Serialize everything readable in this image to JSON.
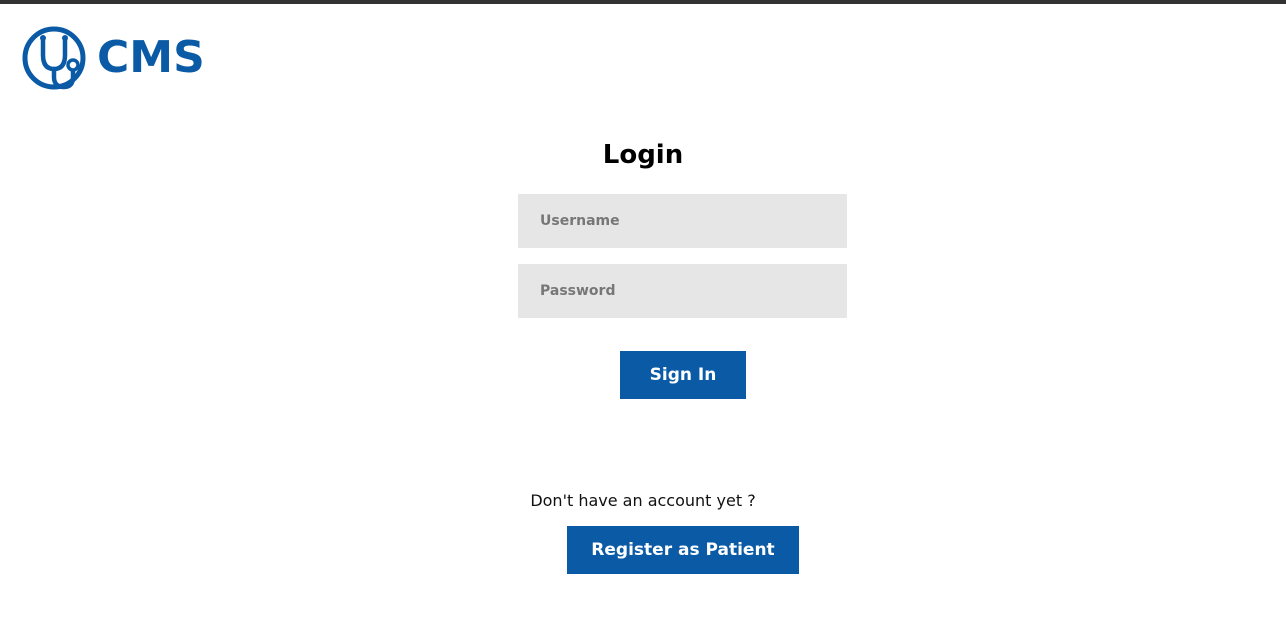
{
  "header": {
    "logo_text": "CMS",
    "logo_icon": "stethoscope-icon"
  },
  "login": {
    "title": "Login",
    "username_placeholder": "Username",
    "username_value": "",
    "password_placeholder": "Password",
    "password_value": "",
    "signin_label": "Sign In"
  },
  "register": {
    "prompt": "Don't have an account yet ?",
    "button_label": "Register as Patient"
  },
  "colors": {
    "brand": "#0a5aa6",
    "field_bg": "#e6e6e6",
    "topbar": "#333333"
  }
}
